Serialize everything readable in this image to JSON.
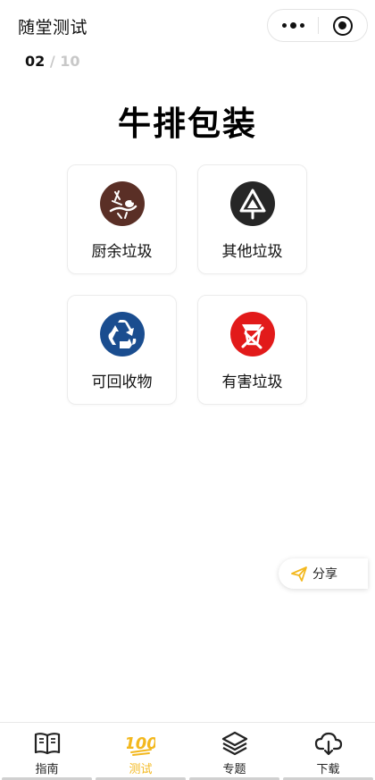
{
  "header": {
    "title": "随堂测试"
  },
  "progress": {
    "current": "02",
    "separator": "/",
    "total": "10"
  },
  "question": {
    "title": "牛排包装"
  },
  "options": [
    {
      "label": "厨余垃圾",
      "icon": "food-waste-icon",
      "color": "#5a2f26"
    },
    {
      "label": "其他垃圾",
      "icon": "residual-waste-icon",
      "color": "#262626"
    },
    {
      "label": "可回收物",
      "icon": "recyclable-icon",
      "color": "#1a4d8f"
    },
    {
      "label": "有害垃圾",
      "icon": "hazardous-waste-icon",
      "color": "#e21a1a"
    }
  ],
  "share": {
    "label": "分享",
    "icon": "share-icon",
    "accent": "#f3b81e"
  },
  "tabs": [
    {
      "label": "指南",
      "icon": "book-icon"
    },
    {
      "label": "测试",
      "icon": "hundred-icon",
      "active": true
    },
    {
      "label": "专题",
      "icon": "layers-icon"
    },
    {
      "label": "下载",
      "icon": "cloud-download-icon"
    }
  ],
  "colors": {
    "accent": "#f3b81e",
    "text": "#111111",
    "muted": "#c8c8c8"
  }
}
